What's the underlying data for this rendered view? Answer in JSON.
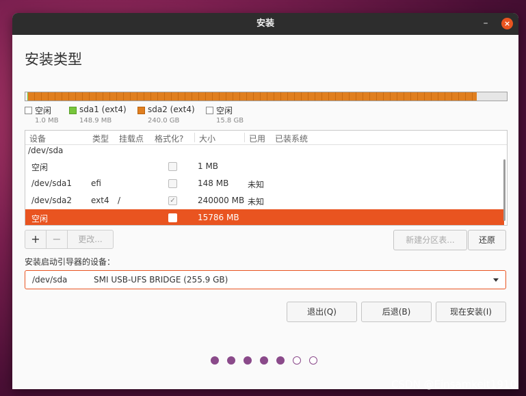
{
  "window": {
    "title": "安装",
    "min_glyph": "–",
    "close_glyph": "×"
  },
  "page_title": "安装类型",
  "legend": [
    {
      "name": "空闲",
      "size": "1.0 MB",
      "color": "#ffffff"
    },
    {
      "name": "sda1 (ext4)",
      "size": "148.9 MB",
      "color": "#78c63c"
    },
    {
      "name": "sda2 (ext4)",
      "size": "240.0 GB",
      "color": "#e07f20"
    },
    {
      "name": "空闲",
      "size": "15.8 GB",
      "color": "#ffffff"
    }
  ],
  "table": {
    "headers": [
      "设备",
      "类型",
      "挂载点",
      "格式化?",
      "大小",
      "已用",
      "已装系统"
    ],
    "group": "/dev/sda",
    "rows": [
      {
        "device": "空闲",
        "type": "",
        "mount": "",
        "format": false,
        "size": "1 MB",
        "used": "",
        "system": "",
        "selected": false
      },
      {
        "device": "/dev/sda1",
        "type": "efi",
        "mount": "",
        "format": false,
        "size": "148 MB",
        "used": "未知",
        "system": "",
        "selected": false
      },
      {
        "device": "/dev/sda2",
        "type": "ext4",
        "mount": "/",
        "format": true,
        "size": "240000 MB",
        "used": "未知",
        "system": "",
        "selected": false
      },
      {
        "device": "空闲",
        "type": "",
        "mount": "",
        "format": false,
        "size": "15786 MB",
        "used": "",
        "system": "",
        "selected": true
      }
    ]
  },
  "toolbar": {
    "add": "+",
    "remove": "−",
    "change": "更改...",
    "new_table": "新建分区表...",
    "revert": "还原"
  },
  "bootloader": {
    "label": "安装启动引导器的设备：",
    "device": "/dev/sda",
    "description": "SMI USB-UFS BRIDGE (255.9 GB)"
  },
  "buttons": {
    "quit": "退出(Q)",
    "back": "后退(B)",
    "install": "现在安装(I)"
  },
  "progress": {
    "total": 7,
    "completed": 5
  },
  "watermark": "CSDN @Einsamkeit1910",
  "colors": {
    "accent": "#e95420",
    "progress_dot": "#8a4a8a"
  }
}
